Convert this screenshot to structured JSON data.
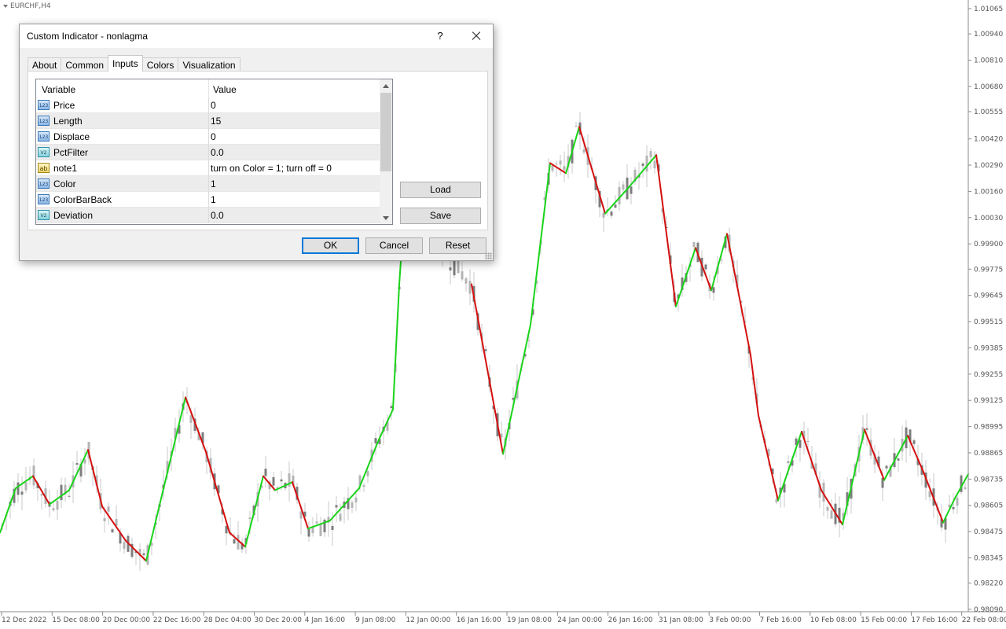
{
  "chart": {
    "symbol": "EURCHF,H4",
    "price_labels": [
      "1.01065",
      "1.00940",
      "1.00810",
      "1.00680",
      "1.00555",
      "1.00420",
      "1.00290",
      "1.00160",
      "1.00030",
      "0.99900",
      "0.99775",
      "0.99645",
      "0.99515",
      "0.99385",
      "0.99255",
      "0.99125",
      "0.98995",
      "0.98865",
      "0.98735",
      "0.98605",
      "0.98475",
      "0.98345",
      "0.98220",
      "0.98090"
    ],
    "time_labels": [
      "12 Dec 2022",
      "15 Dec 08:00",
      "20 Dec 00:00",
      "22 Dec 16:00",
      "28 Dec 04:00",
      "30 Dec 20:00",
      "4 Jan 16:00",
      "9 Jan 08:00",
      "12 Jan 00:00",
      "16 Jan 16:00",
      "19 Jan 08:00",
      "24 Jan 00:00",
      "26 Jan 16:00",
      "31 Jan 08:00",
      "3 Feb 00:00",
      "7 Feb 16:00",
      "10 Feb 08:00",
      "15 Feb 00:00",
      "17 Feb 16:00",
      "22 Feb 08:00"
    ],
    "colors": {
      "up_line": "#19d419",
      "down_line": "#d40f0f",
      "candles": "#8c8c8c",
      "grid": "#e6e6e6"
    },
    "nonlagma": [
      [
        0,
        0.9847
      ],
      [
        20,
        0.9869
      ],
      [
        42,
        0.9875
      ],
      [
        63,
        0.9861
      ],
      [
        88,
        0.9868
      ],
      [
        112,
        0.9888
      ],
      [
        130,
        0.986
      ],
      [
        160,
        0.9843
      ],
      [
        186,
        0.9833
      ],
      [
        210,
        0.9872
      ],
      [
        236,
        0.9914
      ],
      [
        262,
        0.9887
      ],
      [
        292,
        0.9847
      ],
      [
        312,
        0.984
      ],
      [
        335,
        0.9875
      ],
      [
        350,
        0.9868
      ],
      [
        372,
        0.9872
      ],
      [
        392,
        0.9849
      ],
      [
        420,
        0.9853
      ],
      [
        457,
        0.9869
      ],
      [
        482,
        0.9893
      ],
      [
        500,
        0.9908
      ],
      [
        508,
        0.997
      ],
      [
        515,
        1.001
      ],
      [
        600,
        0.997
      ],
      [
        640,
        0.9886
      ],
      [
        675,
        0.995
      ],
      [
        700,
        1.003
      ],
      [
        720,
        1.0025
      ],
      [
        737,
        1.0048
      ],
      [
        770,
        1.0005
      ],
      [
        800,
        1.0018
      ],
      [
        835,
        1.0034
      ],
      [
        860,
        0.9959
      ],
      [
        885,
        0.9988
      ],
      [
        905,
        0.9967
      ],
      [
        925,
        0.9995
      ],
      [
        955,
        0.9935
      ],
      [
        965,
        0.9905
      ],
      [
        990,
        0.9863
      ],
      [
        1020,
        0.9897
      ],
      [
        1045,
        0.9868
      ],
      [
        1072,
        0.9851
      ],
      [
        1100,
        0.9898
      ],
      [
        1125,
        0.9873
      ],
      [
        1155,
        0.9895
      ],
      [
        1175,
        0.9877
      ],
      [
        1200,
        0.9852
      ],
      [
        1215,
        0.9864
      ],
      [
        1232,
        0.9876
      ]
    ]
  },
  "dialog": {
    "title": "Custom Indicator - nonlagma",
    "help": "?",
    "tabs": [
      "About",
      "Common",
      "Inputs",
      "Colors",
      "Visualization"
    ],
    "active_tab": "Inputs",
    "columns": {
      "variable": "Variable",
      "value": "Value"
    },
    "rows": [
      {
        "type": "int",
        "icon": "123",
        "name": "Price",
        "value": "0"
      },
      {
        "type": "int",
        "icon": "123",
        "name": "Length",
        "value": "15"
      },
      {
        "type": "int",
        "icon": "123",
        "name": "Displace",
        "value": "0"
      },
      {
        "type": "double",
        "icon": "V2",
        "name": "PctFilter",
        "value": "0.0"
      },
      {
        "type": "string",
        "icon": "ab",
        "name": "note1",
        "value": "turn on Color = 1; turn off = 0"
      },
      {
        "type": "int",
        "icon": "123",
        "name": "Color",
        "value": "1"
      },
      {
        "type": "int",
        "icon": "123",
        "name": "ColorBarBack",
        "value": "1"
      },
      {
        "type": "double",
        "icon": "V2",
        "name": "Deviation",
        "value": "0.0"
      }
    ],
    "buttons": {
      "load": "Load",
      "save": "Save",
      "ok": "OK",
      "cancel": "Cancel",
      "reset": "Reset"
    }
  }
}
